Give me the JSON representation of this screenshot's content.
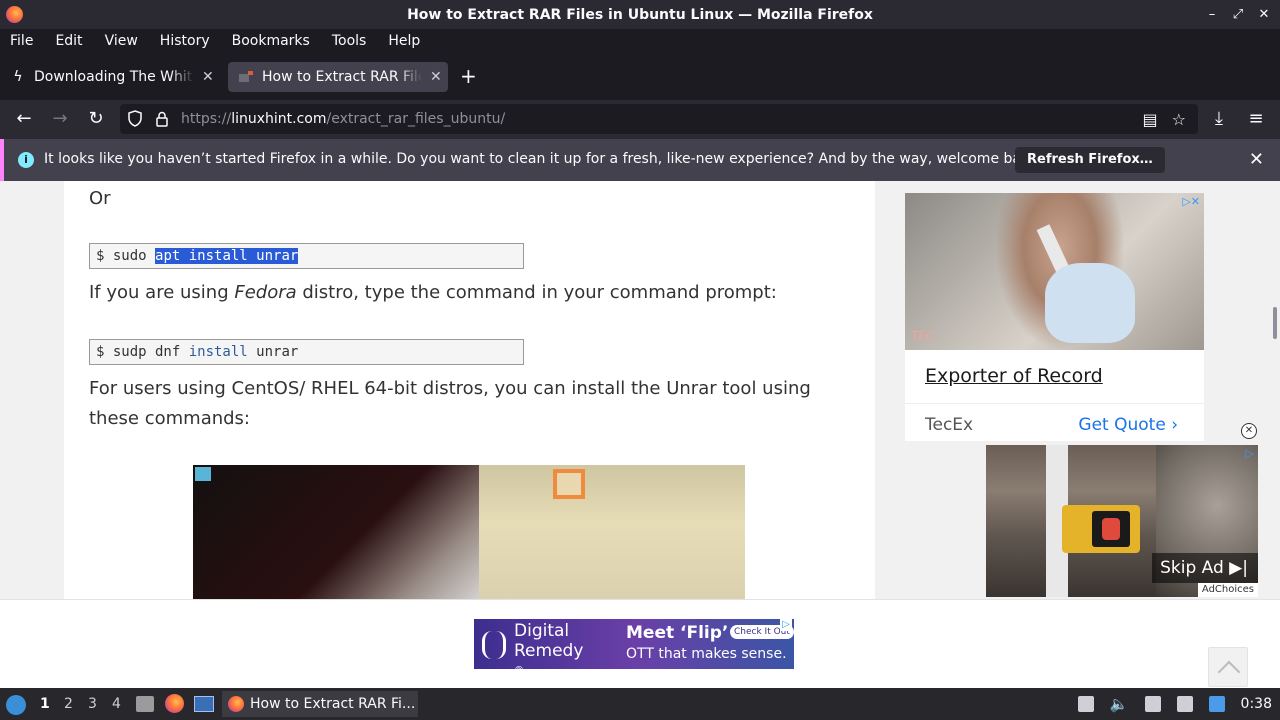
{
  "window": {
    "title": "How to Extract RAR Files in Ubuntu Linux — Mozilla Firefox",
    "controls": [
      "minimize",
      "maximize",
      "close"
    ]
  },
  "menu": {
    "items": [
      "File",
      "Edit",
      "View",
      "History",
      "Bookmarks",
      "Tools",
      "Help"
    ]
  },
  "tabs": [
    {
      "label": "Downloading The White Lotus",
      "icon": "bolt-icon"
    },
    {
      "label": "How to Extract RAR Files in Ubuntu Linux",
      "icon": "site-favicon",
      "active": true
    }
  ],
  "nav": {
    "url_prefix": "https://",
    "url_domain": "linuxhint.com",
    "url_path": "/extract_rar_files_ubuntu/"
  },
  "notification": {
    "message": "It looks like you haven’t started Firefox in a while. Do you want to clean it up for a fresh, like-new experience? And by the way, welcome back!",
    "button": "Refresh Firefox…"
  },
  "article": {
    "or_text": "Or",
    "code1_prompt": "$ sudo ",
    "code1_selected": "apt install unrar",
    "fedora_pre": "If you are using ",
    "fedora_em": "Fedora",
    "fedora_post": " distro, type the command in your command prompt:",
    "code2_prompt": "$ sudp dnf ",
    "code2_kw": "install",
    "code2_rest": " unrar",
    "centos_text": "For users using CentOS/ RHEL 64-bit distros, you can install the Unrar tool using these commands:"
  },
  "right_ad": {
    "headline": "Exporter of Record",
    "brand": "TecEx",
    "cta": "Get Quote",
    "image_logo": "TEC"
  },
  "video_ad": {
    "skip_label": "Skip Ad",
    "adchoices": "AdChoices"
  },
  "bottom_ad": {
    "brand_line1": "Digital",
    "brand_line2": "Remedy",
    "brand_mark": "®",
    "headline": "Meet ‘Flip’",
    "tagline": "OTT that makes sense.",
    "check": "Check It Out"
  },
  "taskbar": {
    "workspaces": [
      "1",
      "2",
      "3",
      "4"
    ],
    "active_workspace": "1",
    "task_label": "How to Extract RAR Fi...",
    "clock": "0:38"
  },
  "colors": {
    "accent": "#ff84fb",
    "link": "#1a73e8",
    "selection": "#2a5bd7"
  }
}
